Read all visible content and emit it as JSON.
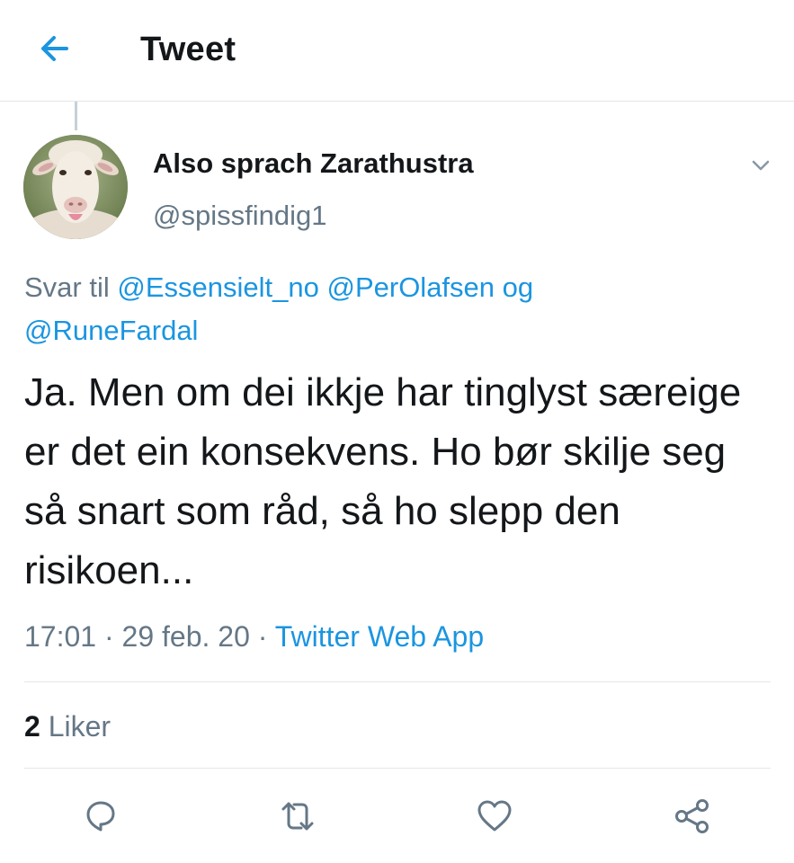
{
  "header": {
    "title": "Tweet",
    "back_icon": "arrow-left-icon"
  },
  "tweet": {
    "author_name": "Also sprach Zarathustra",
    "author_handle": "@spissfindig1",
    "reply_prefix": "Svar til",
    "reply_mentions": [
      "@Essensielt_no",
      "@PerOlafsen"
    ],
    "reply_conjunction": "og",
    "reply_last_mention": "@RuneFardal",
    "text": "Ja. Men om dei ikkje har tinglyst særeige er det ein konsekvens. Ho bør skilje seg så snart som råd, så ho slepp den risikoen...",
    "time": "17:01",
    "separator": "·",
    "date": "29 feb. 20",
    "source": "Twitter Web App",
    "likes_count": "2",
    "likes_label": "Liker"
  },
  "actions": [
    {
      "icon": "reply-icon"
    },
    {
      "icon": "retweet-icon"
    },
    {
      "icon": "heart-icon"
    },
    {
      "icon": "share-icon"
    }
  ],
  "colors": {
    "accent": "#1b95e0",
    "secondary_text": "#657786",
    "primary_text": "#14171a",
    "divider": "#e3e7ea"
  }
}
